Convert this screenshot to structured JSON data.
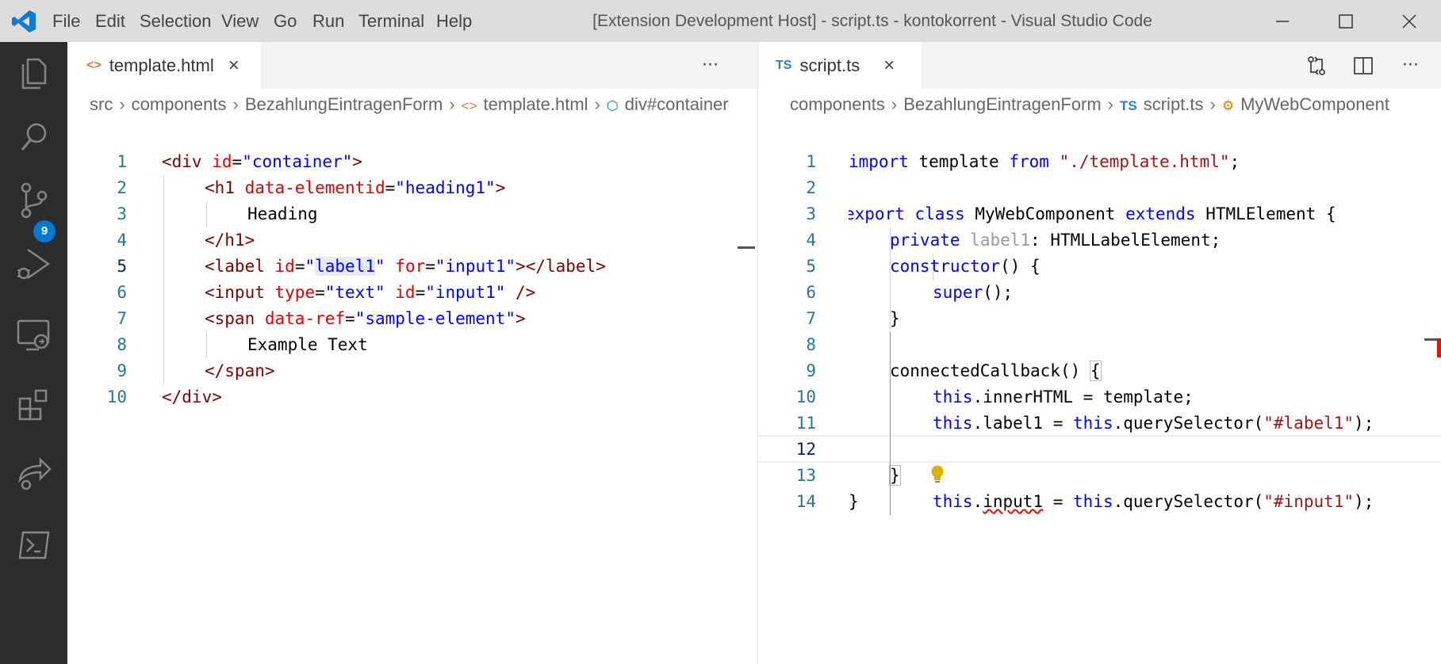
{
  "titlebar": {
    "menu": [
      "File",
      "Edit",
      "Selection",
      "View",
      "Go",
      "Run",
      "Terminal",
      "Help"
    ],
    "title": "[Extension Development Host] - script.ts - kontokorrent - Visual Studio Code"
  },
  "activity_bar": {
    "icons": [
      "explorer-icon",
      "search-icon",
      "source-control-icon",
      "run-debug-icon",
      "remote-explorer-icon",
      "extensions-icon",
      "live-share-icon",
      "powershell-icon"
    ],
    "scm_badge": "9"
  },
  "left_editor": {
    "tab": {
      "icon": "<>",
      "label": "template.html"
    },
    "more": "···",
    "breadcrumbs": [
      "src",
      "components",
      "BezahlungEintragenForm",
      "template.html",
      "div#container"
    ],
    "lines": [
      "1",
      "2",
      "3",
      "4",
      "5",
      "6",
      "7",
      "8",
      "9",
      "10"
    ],
    "active_line": "5"
  },
  "right_editor": {
    "tab": {
      "icon": "TS",
      "label": "script.ts"
    },
    "more": "···",
    "breadcrumbs": [
      "components",
      "BezahlungEintragenForm",
      "script.ts",
      "MyWebComponent"
    ],
    "lines": [
      "1",
      "2",
      "3",
      "4",
      "5",
      "6",
      "7",
      "8",
      "9",
      "10",
      "11",
      "12",
      "13",
      "14"
    ],
    "active_line": "12"
  },
  "colors": {
    "titlebar": "#dddddd",
    "activitybar": "#2c2c2c",
    "accent": "#0078d4",
    "tag": "#800000",
    "attribute": "#e50000",
    "string": "#0000ff",
    "keyword": "#0000ff"
  }
}
